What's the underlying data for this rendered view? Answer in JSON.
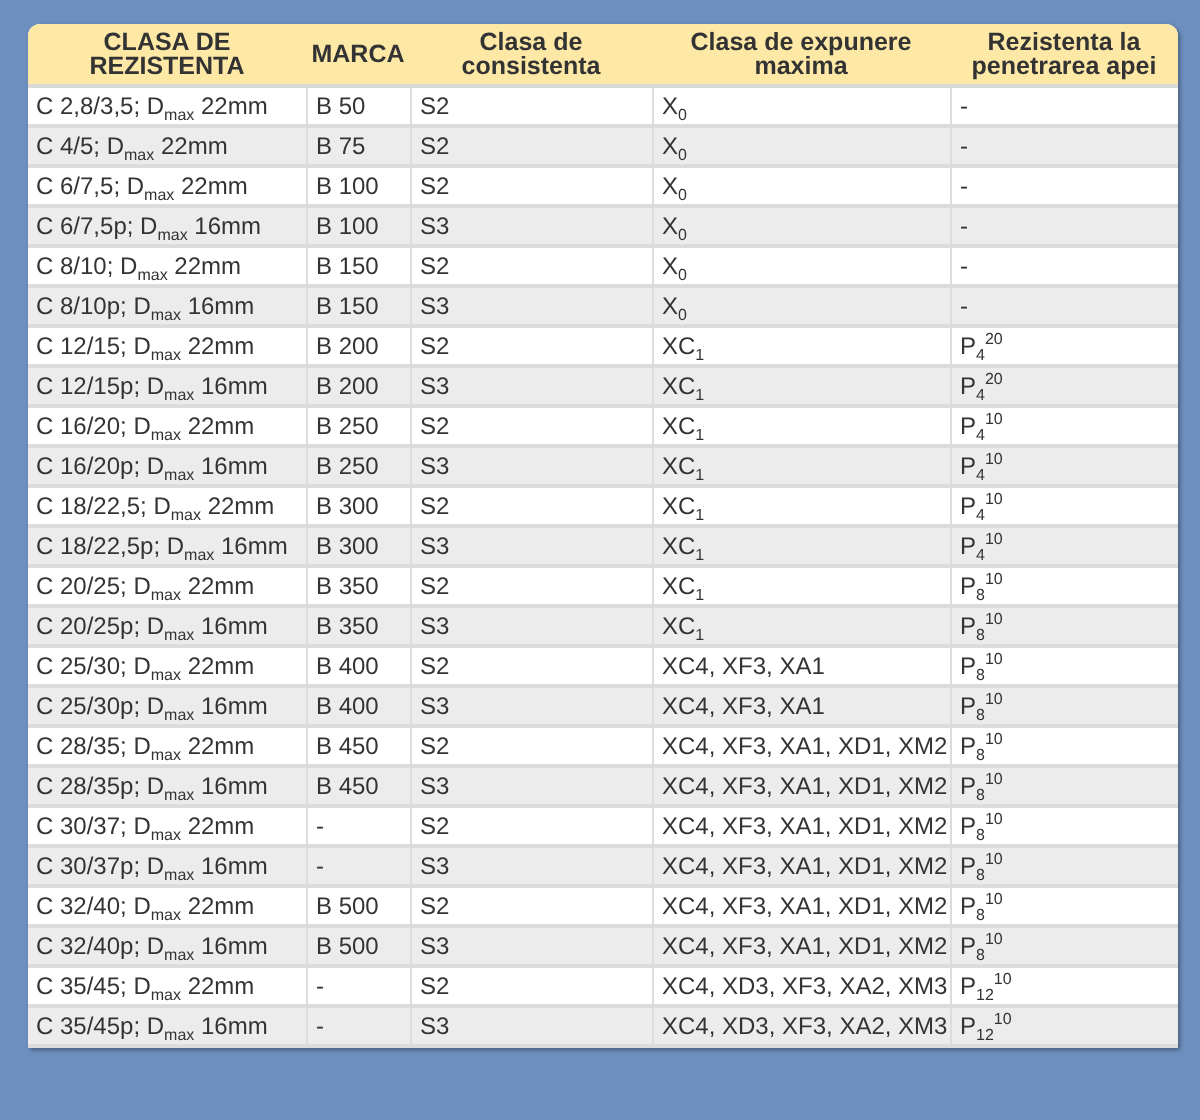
{
  "table": {
    "columns": [
      "CLASA DE REZISTENTA",
      "MARCA",
      "Clasa de consistenta",
      "Clasa de expunere maxima",
      "Rezistenta la penetrarea apei"
    ],
    "rows": [
      [
        "C 2,8/3,5; D$_{max}$ 22mm",
        "B 50",
        "S2",
        "X$_{0}$",
        "-"
      ],
      [
        "C 4/5; D$_{max}$ 22mm",
        "B 75",
        "S2",
        "X$_{0}$",
        "-"
      ],
      [
        "C 6/7,5; D$_{max}$ 22mm",
        "B 100",
        "S2",
        "X$_{0}$",
        "-"
      ],
      [
        "C 6/7,5p; D$_{max}$ 16mm",
        "B 100",
        "S3",
        "X$_{0}$",
        "-"
      ],
      [
        "C 8/10; D$_{max}$ 22mm",
        "B 150",
        "S2",
        "X$_{0}$",
        "-"
      ],
      [
        "C 8/10p; D$_{max}$ 16mm",
        "B 150",
        "S3",
        "X$_{0}$",
        "-"
      ],
      [
        "C 12/15; D$_{max}$ 22mm",
        "B 200",
        "S2",
        "XC$_{1}$",
        "P$_{4}$$^{20}$"
      ],
      [
        "C 12/15p; D$_{max}$ 16mm",
        "B 200",
        "S3",
        "XC$_{1}$",
        "P$_{4}$$^{20}$"
      ],
      [
        "C 16/20; D$_{max}$ 22mm",
        "B 250",
        "S2",
        "XC$_{1}$",
        "P$_{4}$$^{10}$"
      ],
      [
        "C 16/20p; D$_{max}$ 16mm",
        "B 250",
        "S3",
        "XC$_{1}$",
        "P$_{4}$$^{10}$"
      ],
      [
        "C 18/22,5; D$_{max}$ 22mm",
        "B 300",
        "S2",
        "XC$_{1}$",
        "P$_{4}$$^{10}$"
      ],
      [
        "C 18/22,5p; D$_{max}$ 16mm",
        "B 300",
        "S3",
        "XC$_{1}$",
        "P$_{4}$$^{10}$"
      ],
      [
        "C 20/25; D$_{max}$ 22mm",
        "B 350",
        "S2",
        "XC$_{1}$",
        "P$_{8}$$^{10}$"
      ],
      [
        "C 20/25p; D$_{max}$ 16mm",
        "B 350",
        "S3",
        "XC$_{1}$",
        "P$_{8}$$^{10}$"
      ],
      [
        "C 25/30; D$_{max}$ 22mm",
        "B 400",
        "S2",
        "XC4, XF3, XA1",
        "P$_{8}$$^{10}$"
      ],
      [
        "C 25/30p; D$_{max}$ 16mm",
        "B 400",
        "S3",
        "XC4, XF3, XA1",
        "P$_{8}$$^{10}$"
      ],
      [
        "C 28/35; D$_{max}$ 22mm",
        "B 450",
        "S2",
        "XC4, XF3, XA1, XD1, XM2",
        "P$_{8}$$^{10}$"
      ],
      [
        "C 28/35p; D$_{max}$ 16mm",
        "B 450",
        "S3",
        "XC4, XF3, XA1, XD1, XM2",
        "P$_{8}$$^{10}$"
      ],
      [
        "C 30/37; D$_{max}$ 22mm",
        "-",
        "S2",
        "XC4, XF3, XA1, XD1, XM2",
        "P$_{8}$$^{10}$"
      ],
      [
        "C 30/37p; D$_{max}$ 16mm",
        "-",
        "S3",
        "XC4, XF3, XA1, XD1, XM2",
        "P$_{8}$$^{10}$"
      ],
      [
        "C 32/40; D$_{max}$ 22mm",
        "B 500",
        "S2",
        "XC4, XF3, XA1, XD1, XM2",
        "P$_{8}$$^{10}$"
      ],
      [
        "C 32/40p; D$_{max}$ 16mm",
        "B 500",
        "S3",
        "XC4, XF3, XA1, XD1, XM2",
        "P$_{8}$$^{10}$"
      ],
      [
        "C 35/45; D$_{max}$ 22mm",
        "-",
        "S2",
        "XC4, XD3, XF3, XA2, XM3",
        "P$_{12}$$^{10}$"
      ],
      [
        "C 35/45p; D$_{max}$ 16mm",
        "-",
        "S3",
        "XC4, XD3, XF3, XA2, XM3",
        "P$_{12}$$^{10}$"
      ]
    ]
  }
}
